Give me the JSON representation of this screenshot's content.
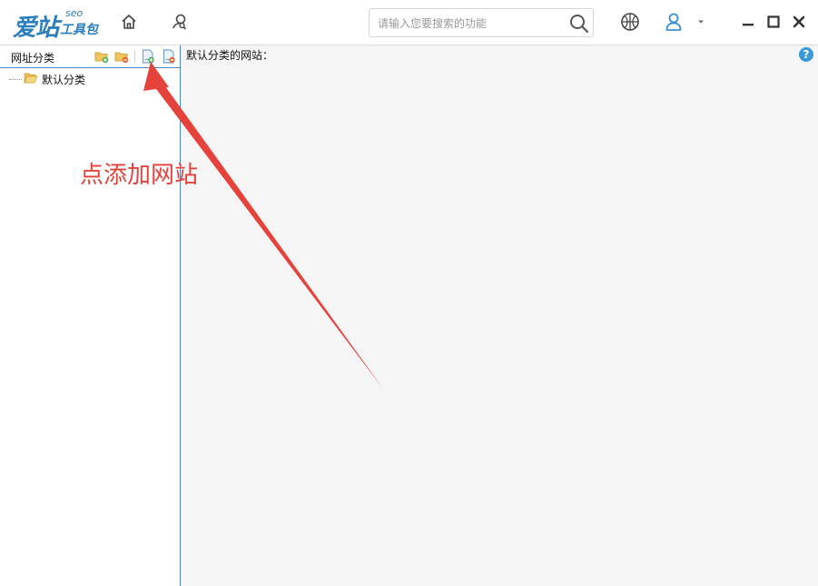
{
  "app": {
    "logo_main": "爱站",
    "logo_sub": "工具包",
    "logo_seo": "seo"
  },
  "toolbar": {
    "icons": [
      "home-icon",
      "user-search-icon",
      "basketball-icon",
      "user-icon",
      "caret-down-icon",
      "minimize-icon",
      "maximize-icon",
      "close-icon"
    ]
  },
  "search": {
    "placeholder": "请输入您要搜索的功能",
    "value": ""
  },
  "left_panel": {
    "title": "网址分类",
    "tools": [
      "add-category-icon",
      "delete-category-icon",
      "add-site-icon",
      "delete-site-icon"
    ],
    "tree": [
      {
        "label": "默认分类",
        "icon": "folder-open-icon"
      }
    ]
  },
  "right_panel": {
    "title": "默认分类的网站："
  },
  "annotation": {
    "text": "点添加网站",
    "color": "#e5423b"
  },
  "colors": {
    "brand": "#2a7ebd",
    "panel_border": "#4a86c5",
    "help": "#3a9ad9"
  }
}
